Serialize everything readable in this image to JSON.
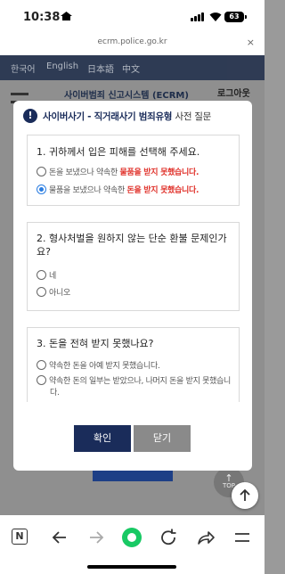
{
  "status": {
    "time": "10:38",
    "battery": "63"
  },
  "browser": {
    "url": "ecrm.police.go.kr",
    "close": "×"
  },
  "background": {
    "languages": [
      "한국어",
      "English",
      "日本語",
      "中文"
    ],
    "site_title": "사이버범죄 신고시스템 (ECRM)",
    "logout": "로그아웃",
    "top_label": "TOP"
  },
  "modal": {
    "title_main": "사이버사기 - 직거래사기 범죄유형",
    "title_sub": "사전 질문",
    "q1": {
      "question": "1. 귀하께서 입은 피해를 선택해 주세요.",
      "opt1_pre": "돈을 보냈으나 약속한 ",
      "opt1_red": "물품을 받지 못했습니다.",
      "opt2_pre": "물품을 보냈으나 약속한 ",
      "opt2_red": "돈을 받지 못했습니다."
    },
    "q2": {
      "question": "2. 형사처벌을 원하지 않는 단순 환불 문제인가요?",
      "opt_yes": "네",
      "opt_no": "아니오"
    },
    "q3": {
      "question": "3. 돈을 전혀 받지 못했나요?",
      "opt1": "약속한 돈을 아예 받지 못했습니다.",
      "opt2": "약속한 돈의 일부는 받았으나, 나머지 돈을 받지 못했습니다."
    },
    "confirm": "확인",
    "close": "닫기"
  },
  "toolbar": {
    "n_label": "N"
  }
}
